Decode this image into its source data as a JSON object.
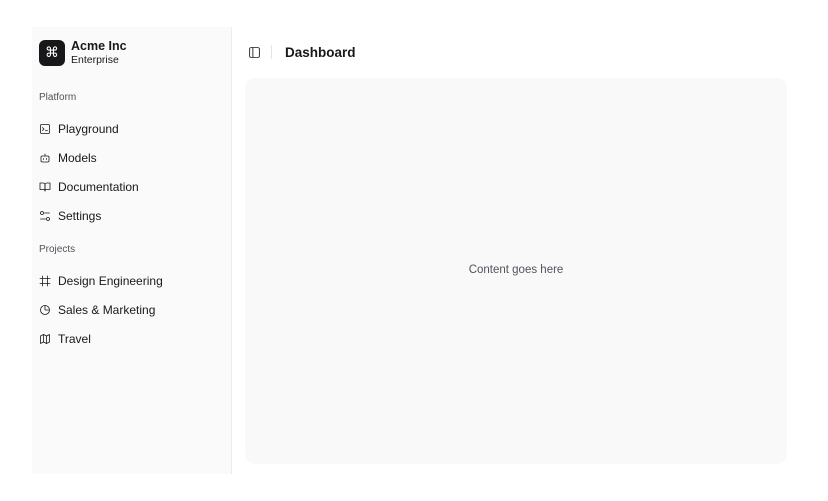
{
  "sidebar": {
    "brand": {
      "name": "Acme Inc",
      "plan": "Enterprise",
      "logo_glyph": "⌘",
      "logo_icon": "command-icon"
    },
    "platform": {
      "label": "Platform",
      "items": [
        {
          "label": "Playground",
          "icon": "terminal-icon"
        },
        {
          "label": "Models",
          "icon": "bot-icon"
        },
        {
          "label": "Documentation",
          "icon": "book-open-icon"
        },
        {
          "label": "Settings",
          "icon": "settings-sliders-icon"
        }
      ]
    },
    "projects": {
      "label": "Projects",
      "items": [
        {
          "label": "Design Engineering",
          "icon": "frame-icon"
        },
        {
          "label": "Sales & Marketing",
          "icon": "pie-chart-icon"
        },
        {
          "label": "Travel",
          "icon": "map-icon"
        }
      ]
    }
  },
  "header": {
    "title": "Dashboard",
    "toggle_icon": "sidebar-toggle-icon"
  },
  "main": {
    "placeholder": "Content goes here"
  },
  "colors": {
    "sidebar_bg": "#fafafa",
    "content_bg": "#f9f9f9",
    "text": "#18181b",
    "muted": "#52525b"
  }
}
